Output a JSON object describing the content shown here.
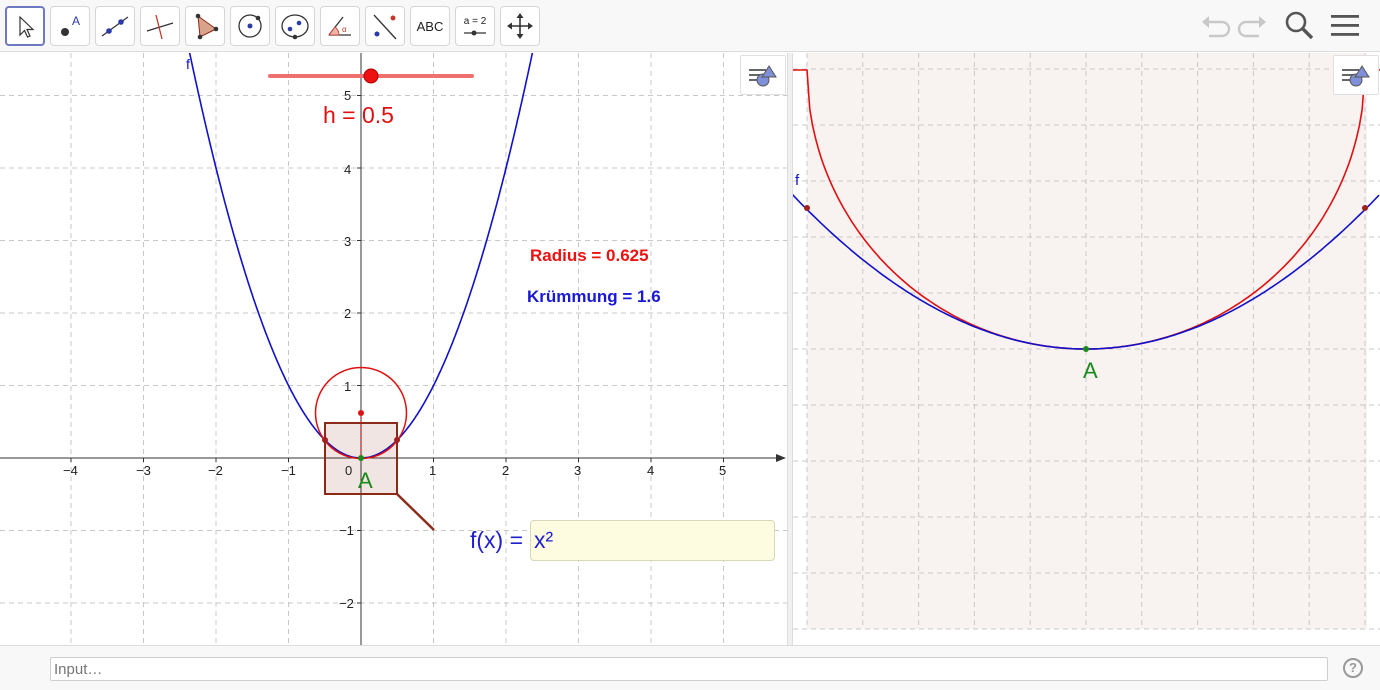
{
  "toolbar": {
    "tools": [
      {
        "name": "move-tool",
        "icon": "arrow-cursor-icon",
        "active": true
      },
      {
        "name": "point-tool",
        "icon": "point-icon"
      },
      {
        "name": "line-tool",
        "icon": "line-through-points-icon"
      },
      {
        "name": "perpendicular-tool",
        "icon": "perpendicular-line-icon"
      },
      {
        "name": "polygon-tool",
        "icon": "polygon-icon"
      },
      {
        "name": "circle-tool",
        "icon": "circle-center-point-icon"
      },
      {
        "name": "ellipse-tool",
        "icon": "ellipse-icon"
      },
      {
        "name": "angle-tool",
        "icon": "angle-icon"
      },
      {
        "name": "reflect-tool",
        "icon": "reflect-about-line-icon"
      },
      {
        "name": "text-tool",
        "label": "ABC"
      },
      {
        "name": "slider-tool",
        "label": "a = 2"
      },
      {
        "name": "move-graphics-tool",
        "icon": "move-graphics-view-icon"
      }
    ],
    "right_icons": [
      "undo-icon",
      "redo-icon",
      "search-icon",
      "menu-icon"
    ]
  },
  "graphics1": {
    "x_ticks": [
      "−4",
      "−3",
      "−2",
      "−1",
      "0",
      "1",
      "2",
      "3",
      "4",
      "5"
    ],
    "y_ticks": [
      "5",
      "4",
      "3",
      "2",
      "1",
      "−1",
      "−2"
    ],
    "function_label": "f",
    "point_label": "A",
    "slider_label": "h = 0.5",
    "slider_value": 0.5,
    "radius_text": "Radius = 0.625",
    "kruemmung_text": "Krümmung = 1.6",
    "input_caption": "f(x) =",
    "input_value": "x²"
  },
  "graphics2": {
    "function_label": "f",
    "point_label": "A"
  },
  "input_bar": {
    "placeholder": "Input…",
    "help": "?"
  },
  "colors": {
    "function": "#1111cc",
    "circle": "#e01010",
    "point": "#1a8a1a",
    "zoom_box": "#8b2a16",
    "slider": "#f07070"
  }
}
